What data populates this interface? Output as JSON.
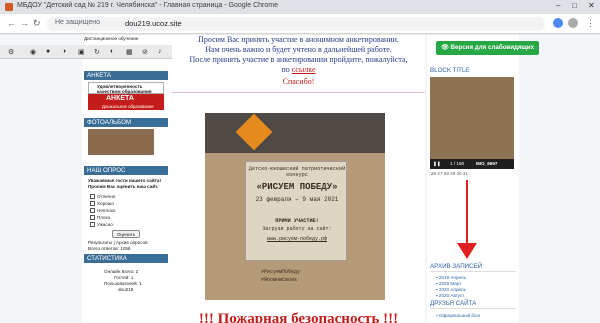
{
  "browser": {
    "window_title": "МБДОУ \"Детский сад № 219 г. Челябинска\" - Главная страница - Google Chrome",
    "secure_label": "Не защищено",
    "url": "dou219.ucoz.site",
    "back_icon": "back-arrow-icon",
    "forward_icon": "forward-arrow-icon",
    "reload_icon": "reload-icon"
  },
  "left": {
    "top_link": "Дистанционное обучение",
    "anketa_title": "АНКЕТА",
    "anketa_banner_top": "Удовлетворенность",
    "anketa_banner_top2": "качеством образования",
    "anketa_word": "АНКЕТА",
    "anketa_sub": "Дошкольное образование",
    "photo_title": "ФОТОАЛЬБОМ",
    "poll_title": "НАШ ОПРОС",
    "poll_question": "Уважаемые гости нашего сайта! Просим Вас оценить наш сайт.",
    "poll_options": [
      "Отлично",
      "Хорошо",
      "Неплохо",
      "Плохо",
      "Ужасно"
    ],
    "vote_label": "Оценить",
    "results_links": "Результаты | Архив опросов",
    "total_votes": "Всего ответов: 1056",
    "stats_title": "СТАТИСТИКА",
    "online_total": "Онлайн всего: 2",
    "guests": "Гостей: 1",
    "users": "Пользователей: 1",
    "user_name": "dou219"
  },
  "center": {
    "line1": "Просим Вас принять участие в анонимном анкетировании.",
    "line2": "Нам очень важно и будет учтено в дальнейшей работе.",
    "line3": "После принять участие в анкетировании пройдите, пожалуйста,",
    "line4_prefix": "по",
    "line4_link": "ссылке",
    "thanks": "Спасибо!",
    "poster_heading": "Детско-юношеский патриотический конкурс",
    "poster_title": "«РИСУЕМ ПОБЕДУ»",
    "poster_dates": "23 февраля – 9 мая 2021",
    "poster_cta": "ПРИМИ УЧАСТИЕ!",
    "poster_cta2": "Загрузи работу на сайт:",
    "poster_site": "www.рисуем-победу.рф",
    "poster_hashtag1": "#РисуемПобеду",
    "poster_hashtag2": "#ЯпомнюСвоих",
    "footer_heading": "!!! Пожарная безопасность !!!"
  },
  "right": {
    "accessibility_button": "Версия для слабовидящих",
    "block_title": "BLOCK TITLE",
    "carousel_counter": "1 / 160",
    "carousel_caption": "IMG_6697",
    "calendar_days": "26  27  28  29  30  31",
    "archive_title": "АРХИВ ЗАПИСЕЙ",
    "archive_items": [
      "2019 Апрель",
      "2020 Март",
      "2020 Апрель",
      "2020 Август"
    ],
    "friends_title": "ДРУЗЬЯ САЙТА",
    "friends_item": "Официальный блог"
  },
  "colors": {
    "accent_red": "#c41b1b",
    "block_blue": "#3a6e96",
    "link_blue": "#2c64a8",
    "green_button": "#27a844"
  }
}
